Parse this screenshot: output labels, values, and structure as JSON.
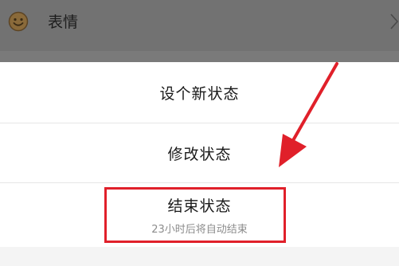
{
  "background_row": {
    "icon": "smiley-face-icon",
    "label": "表情",
    "chevron": "chevron-right-icon"
  },
  "sheet": {
    "options": [
      {
        "label": "设个新状态"
      },
      {
        "label": "修改状态"
      },
      {
        "label": "结束状态",
        "sublabel": "23小时后将自动结束"
      }
    ]
  },
  "colors": {
    "overlay": "#727272",
    "highlight": "#e0202a",
    "emoji": "#d79a3a"
  }
}
